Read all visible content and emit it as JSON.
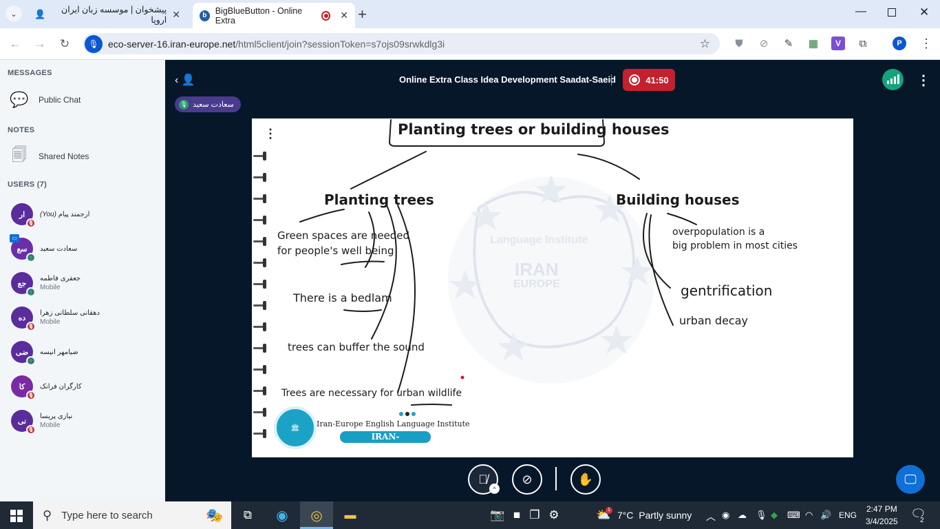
{
  "browser": {
    "tabs": [
      {
        "title": "پیشخوان | موسسه زبان ایران اروپا"
      },
      {
        "title": "BigBlueButton - Online Extra"
      }
    ],
    "url_host": "eco-server-16.iran-europe.net",
    "url_path": "/html5client/join?sessionToken=s7ojs09srwkdlg3i",
    "profile_initial": "P"
  },
  "sidebar": {
    "messages_title": "MESSAGES",
    "public_chat": "Public Chat",
    "notes_title": "NOTES",
    "shared_notes": "Shared Notes",
    "users_title": "USERS (7)",
    "users": [
      {
        "initials": "ار",
        "name": "ارجمند پیام",
        "you": "(You)",
        "sub": "",
        "color": "#5a2c9c",
        "status": "#c0303a"
      },
      {
        "initials": "سع",
        "name": "سعادت سعید",
        "you": "",
        "sub": "",
        "color": "#6a2fa8",
        "status": "#2a9d8f"
      },
      {
        "initials": "جع",
        "name": "جعفری فاطمه",
        "you": "",
        "sub": "Mobile",
        "color": "#5a2c9c",
        "status": "#2a9d8f"
      },
      {
        "initials": "ده",
        "name": "دهقانی سلطانی زهرا",
        "you": "",
        "sub": "Mobile",
        "color": "#5a2c9c",
        "status": "#c0303a"
      },
      {
        "initials": "ضی",
        "name": "ضیامهر انیسه",
        "you": "",
        "sub": "",
        "color": "#5a2c9c",
        "status": "#2a9d8f"
      },
      {
        "initials": "کا",
        "name": "کارگران فرانک",
        "you": "",
        "sub": "",
        "color": "#7b2aa3",
        "status": "#c0303a"
      },
      {
        "initials": "نی",
        "name": "نیازی پریسا",
        "you": "",
        "sub": "Mobile",
        "color": "#5a2c9c",
        "status": "#c0303a"
      }
    ]
  },
  "meeting": {
    "title": "Online Extra Class Idea Development Saadat-Saeid",
    "timer": "41:50",
    "talker": "سعادت سعید"
  },
  "slide": {
    "main_title": "Planting trees or building houses",
    "left_heading": "Planting trees",
    "left_items": [
      "Green spaces are needed",
      "for people's well being",
      "There is a bedlam",
      "trees can buffer the sound",
      "Trees are necessary for urban wildlife"
    ],
    "right_heading": "Building houses",
    "right_items": [
      "overpopulation is a",
      "big problem in most cities",
      "gentrification",
      "urban decay"
    ],
    "watermark_top": "Language Institute",
    "watermark_mid": "IRAN",
    "watermark_bottom": "EUROPE",
    "logo_name": "Iran-Europe English Language Institute",
    "logo_site": "IRAN-EUROPE.NET"
  },
  "taskbar": {
    "search_placeholder": "Type here to search",
    "weather": "7°C  Partly sunny",
    "lang": "ENG",
    "time": "2:47 PM",
    "date": "3/4/2025",
    "notif_count": "2",
    "weather_badge": "1"
  },
  "colors": {
    "accent": "#0f70d7",
    "record": "#c5202d",
    "presenter": "#4a3b8f"
  }
}
